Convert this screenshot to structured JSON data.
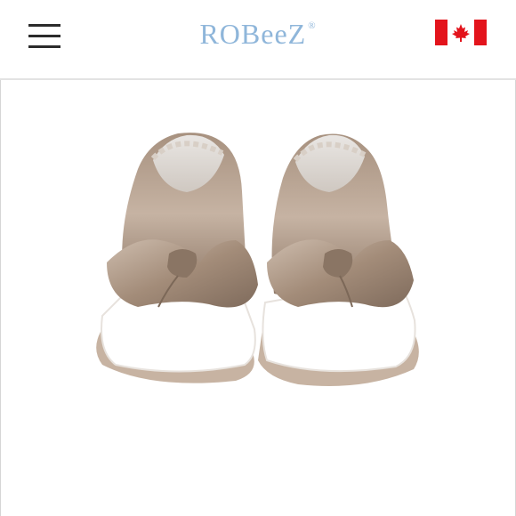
{
  "header": {
    "logo_text": "ROBeeZ",
    "logo_mark": "®",
    "menu_icon": "hamburger-menu-icon",
    "flag_icon": "canada-flag-icon",
    "brand_color": "#8fb6da",
    "flag_color": "#e3141c"
  },
  "product": {
    "image": "metallic-bow-slip-on-baby-shoes",
    "colors": {
      "leather": "#b39f8f",
      "sole": "#ffffff"
    }
  }
}
